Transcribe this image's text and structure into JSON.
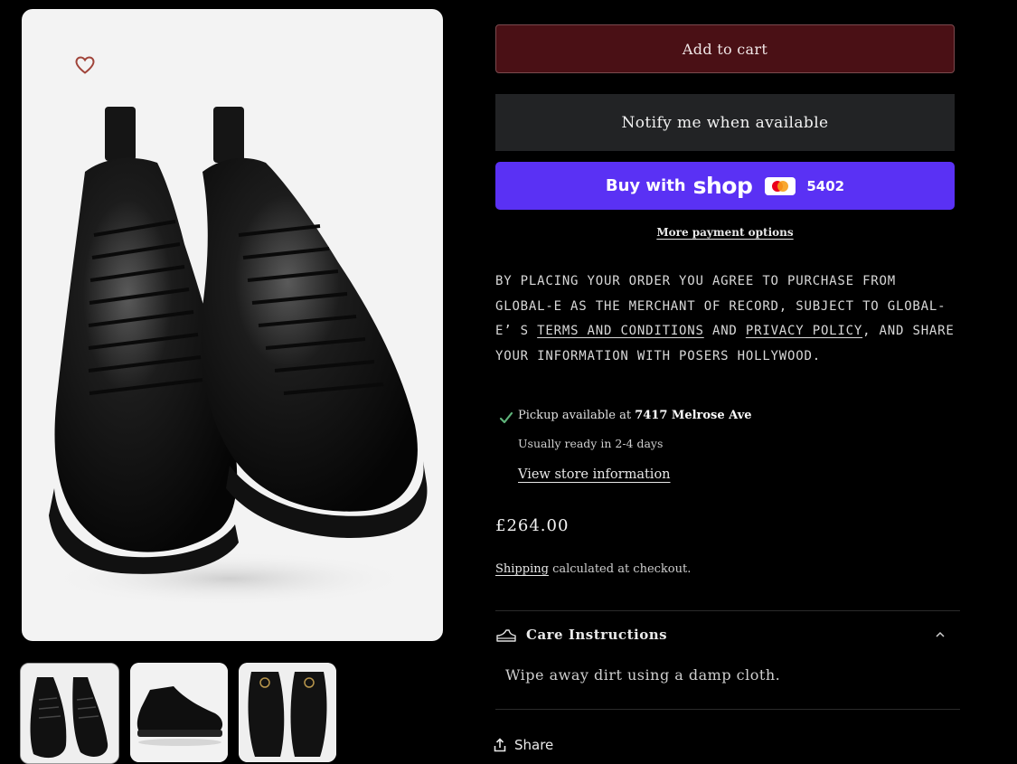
{
  "product": {
    "images": {
      "main_alt": "Black leather monkey boots",
      "thumbnails": [
        "Boots top view",
        "Boot side view",
        "Boots front view"
      ]
    }
  },
  "buttons": {
    "add_to_cart": "Add to cart",
    "notify": "Notify me when available",
    "shop_pay_prefix": "Buy with",
    "shop_pay_brand": "shop",
    "card_last4": "5402",
    "more_payment_options": "More payment options"
  },
  "disclaimer": {
    "part1": "BY PLACING YOUR ORDER YOU AGREE TO PURCHASE FROM GLOBAL-E AS THE MERCHANT OF RECORD, SUBJECT TO GLOBAL-E’ S ",
    "terms_link": "TERMS AND CONDITIONS",
    "part2": " AND ",
    "privacy_link": "PRIVACY POLICY",
    "part3": ", AND SHARE YOUR INFORMATION WITH POSERS HOLLYWOOD."
  },
  "pickup": {
    "prefix": "Pickup available at ",
    "location": "7417 Melrose Ave",
    "ready_time": "Usually ready in 2-4 days",
    "view_store": "View store information"
  },
  "price": "£264.00",
  "shipping": {
    "link": "Shipping",
    "text": " calculated at checkout."
  },
  "care": {
    "title": "Care Instructions",
    "body": "Wipe away dirt using a damp cloth."
  },
  "share_label": "Share",
  "colors": {
    "add_to_cart_bg": "#4a1015",
    "notify_bg": "#222325",
    "shop_pay_bg": "#5a31f4",
    "wishlist_heart": "#a0443a",
    "pickup_check": "#5fb37a"
  }
}
